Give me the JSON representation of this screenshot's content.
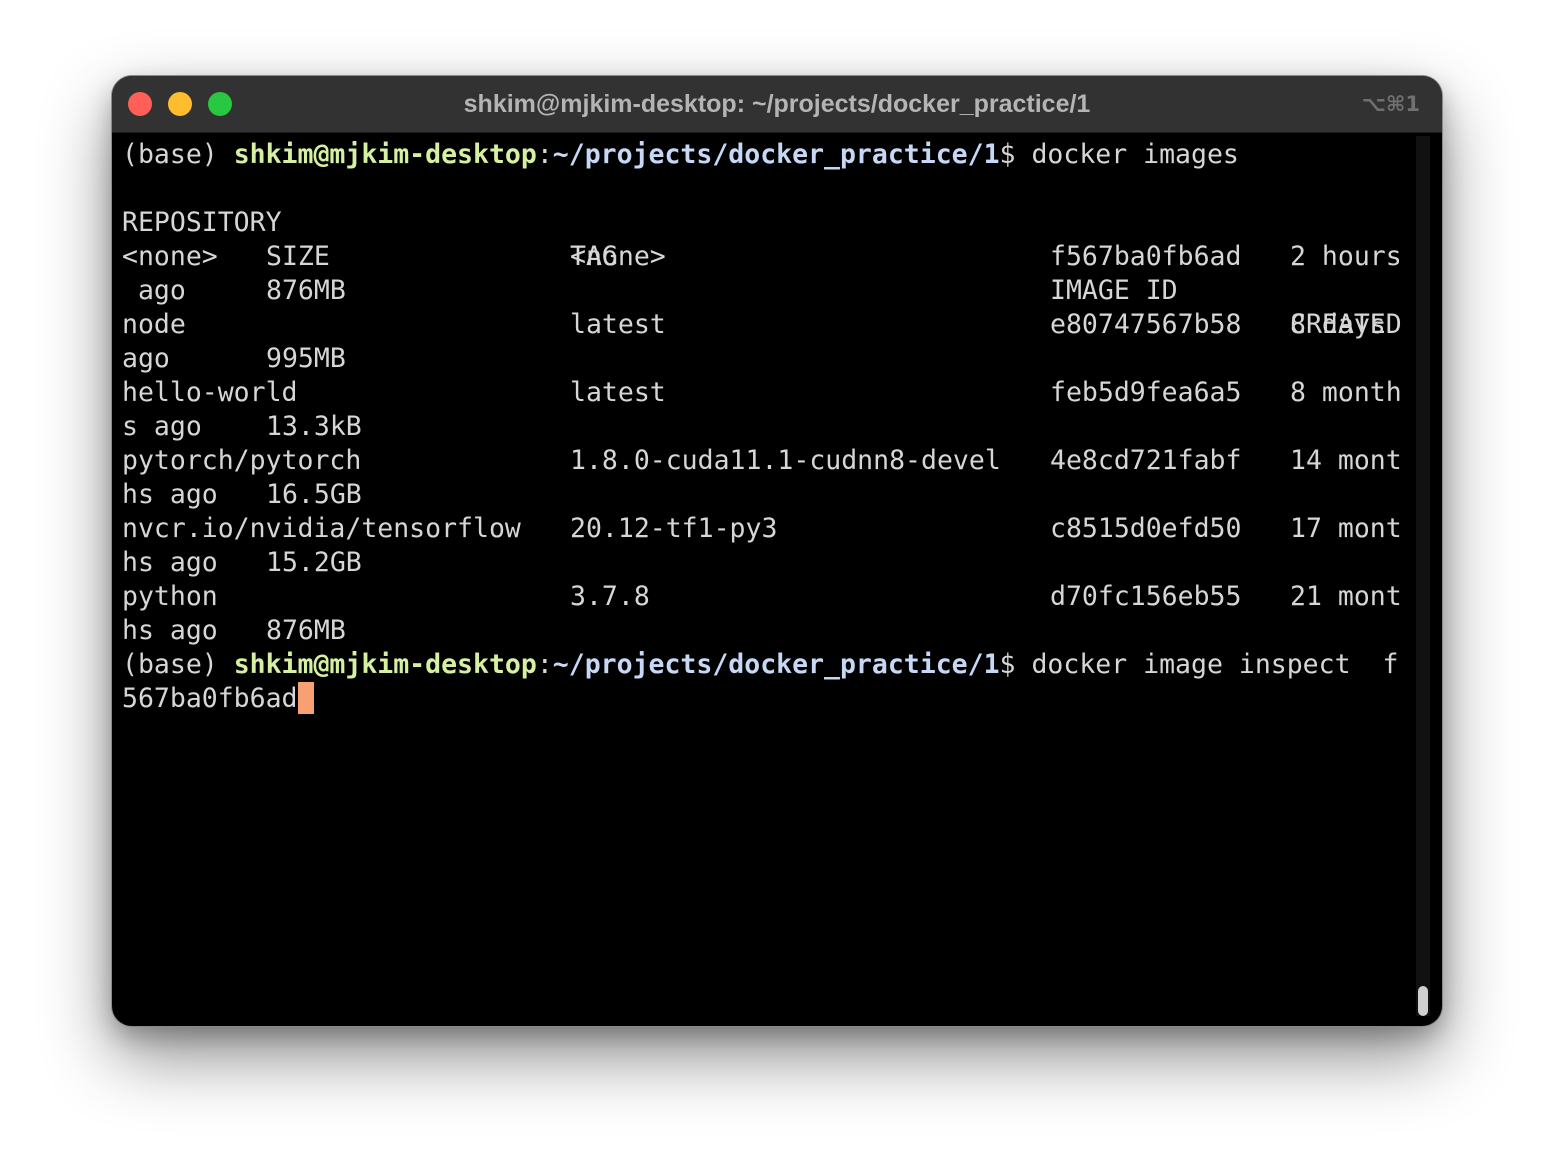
{
  "window": {
    "title": "shkim@mjkim-desktop: ~/projects/docker_practice/1",
    "shortcut": "⌥⌘1"
  },
  "prompt": {
    "env": "(base) ",
    "user_host": "shkim@mjkim-desktop",
    "colon": ":",
    "path": "~/projects/docker_practice/1",
    "dollar": "$ "
  },
  "commands": {
    "first": "docker images",
    "second": "docker image inspect  f",
    "second_wrap": "567ba0fb6ad"
  },
  "table": {
    "headers": {
      "repository": "REPOSITORY",
      "tag": "TAG",
      "image_id": "IMAGE ID",
      "created": "CREATED",
      "size": "SIZE"
    },
    "rows": [
      {
        "repository": "<none>",
        "tag": "<none>",
        "image_id": "f567ba0fb6ad",
        "created_a": "2 hours",
        "created_b": " ago",
        "size": "876MB"
      },
      {
        "repository": "node",
        "tag": "latest",
        "image_id": "e80747567b58",
        "created_a": "8 days",
        "created_b": "ago",
        "size": "995MB"
      },
      {
        "repository": "hello-world",
        "tag": "latest",
        "image_id": "feb5d9fea6a5",
        "created_a": "8 month",
        "created_b": "s ago",
        "size": "13.3kB"
      },
      {
        "repository": "pytorch/pytorch",
        "tag": "1.8.0-cuda11.1-cudnn8-devel",
        "image_id": "4e8cd721fabf",
        "created_a": "14 mont",
        "created_b": "hs ago",
        "size": "16.5GB"
      },
      {
        "repository": "nvcr.io/nvidia/tensorflow",
        "tag": "20.12-tf1-py3",
        "image_id": "c8515d0efd50",
        "created_a": "17 mont",
        "created_b": "hs ago",
        "size": "15.2GB"
      },
      {
        "repository": "python",
        "tag": "3.7.8",
        "image_id": "d70fc156eb55",
        "created_a": "21 mont",
        "created_b": "hs ago",
        "size": "876MB"
      }
    ]
  },
  "colors": {
    "background": "#000000",
    "text": "#d6d6d6",
    "user_host": "#d5f0a0",
    "path": "#c6d8f5",
    "cursor": "#f7a173",
    "titlebar": "#323232",
    "close": "#fe5f57",
    "minimize": "#febc2e",
    "maximize": "#28c840"
  }
}
